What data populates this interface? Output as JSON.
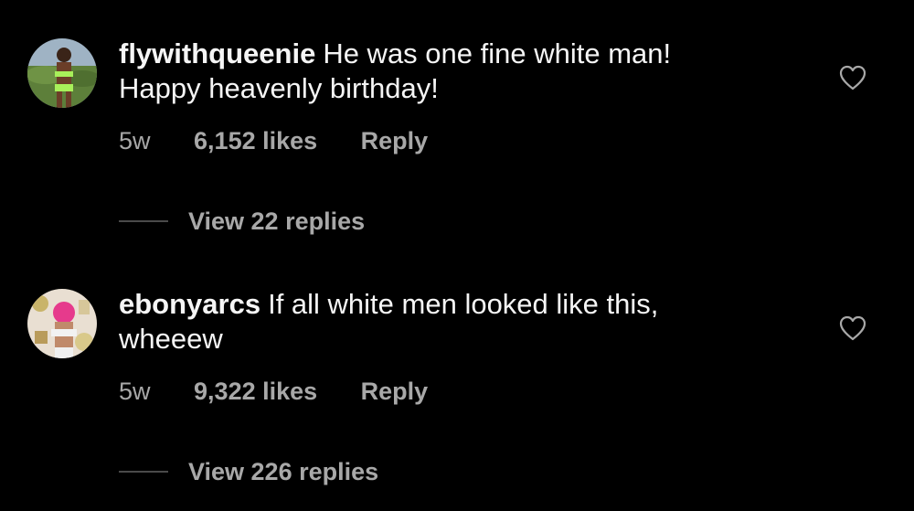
{
  "comments": [
    {
      "username": "flywithqueenie",
      "text": "He was one fine white man!\nHappy heavenly birthday!",
      "time": "5w",
      "likes": "6,152 likes",
      "reply_label": "Reply",
      "view_replies": "View 22 replies",
      "avatar_icon": "avatar-photo",
      "like_icon": "heart-outline-icon"
    },
    {
      "username": "ebonyarcs",
      "text": "If all white men looked like this,\nwheeew",
      "time": "5w",
      "likes": "9,322 likes",
      "reply_label": "Reply",
      "view_replies": "View 226 replies",
      "avatar_icon": "avatar-photo",
      "like_icon": "heart-outline-icon"
    }
  ],
  "colors": {
    "background": "#000000",
    "primary_text": "#f5f5f5",
    "secondary_text": "#a8a8a8",
    "divider": "#4a4a4a"
  }
}
